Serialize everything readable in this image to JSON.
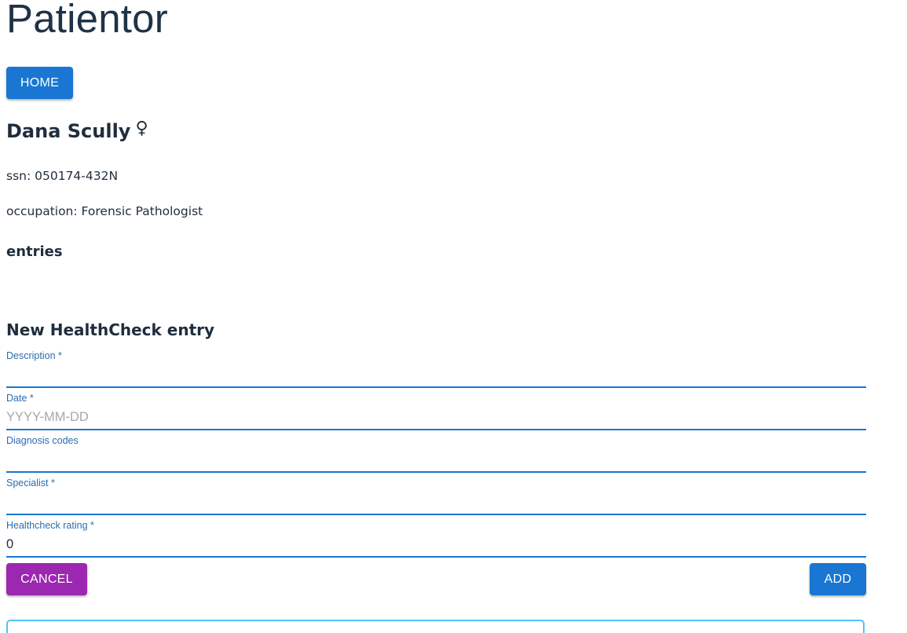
{
  "app": {
    "title": "Patientor"
  },
  "nav": {
    "home_label": "HOME"
  },
  "patient": {
    "name": "Dana Scully",
    "gender_symbol": "♀",
    "ssn_line": "ssn: 050174-432N",
    "occupation_line": "occupation: Forensic Pathologist"
  },
  "entries": {
    "heading": "entries"
  },
  "form": {
    "heading": "New HealthCheck entry",
    "fields": {
      "description": {
        "label": "Description *",
        "value": "",
        "placeholder": ""
      },
      "date": {
        "label": "Date *",
        "value": "",
        "placeholder": "YYYY-MM-DD"
      },
      "diagnosis_codes": {
        "label": "Diagnosis codes",
        "value": "",
        "placeholder": ""
      },
      "specialist": {
        "label": "Specialist *",
        "value": "",
        "placeholder": ""
      },
      "healthcheck_rating": {
        "label": "Healthcheck rating  *",
        "value": "0",
        "placeholder": ""
      }
    },
    "cancel_label": "CANCEL",
    "add_label": "ADD"
  },
  "colors": {
    "primary": "#1976d2",
    "secondary": "#9c27b0",
    "label_blue": "#2b6cb0",
    "text": "#1f2d3d",
    "outline_accent": "#4fc3f7"
  }
}
